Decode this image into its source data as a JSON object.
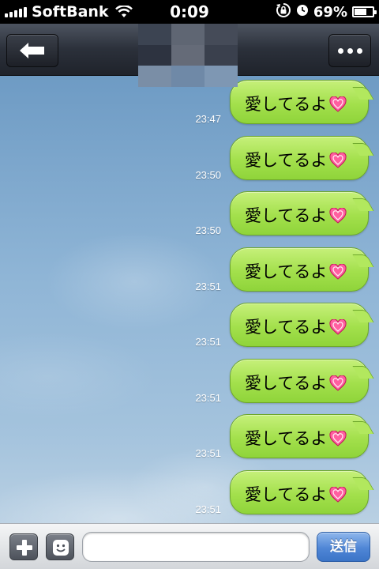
{
  "status_bar": {
    "carrier": "SoftBank",
    "time": "0:09",
    "battery_percent": "69%",
    "battery_level": 0.69,
    "icons": [
      "signal-icon",
      "wifi-icon",
      "rotation-lock-icon",
      "alarm-icon",
      "battery-icon"
    ]
  },
  "nav": {
    "back_icon": "back-arrow-icon",
    "more_icon": "more-dots-icon"
  },
  "messages": [
    {
      "text": "愛してるよ",
      "emoji": "heart-icon",
      "time": "23:47"
    },
    {
      "text": "愛してるよ",
      "emoji": "heart-icon",
      "time": "23:50"
    },
    {
      "text": "愛してるよ",
      "emoji": "heart-icon",
      "time": "23:50"
    },
    {
      "text": "愛してるよ",
      "emoji": "heart-icon",
      "time": "23:51"
    },
    {
      "text": "愛してるよ",
      "emoji": "heart-icon",
      "time": "23:51"
    },
    {
      "text": "愛してるよ",
      "emoji": "heart-icon",
      "time": "23:51"
    },
    {
      "text": "愛してるよ",
      "emoji": "heart-icon",
      "time": "23:51"
    },
    {
      "text": "愛してるよ",
      "emoji": "heart-icon",
      "time": "23:51"
    }
  ],
  "input_bar": {
    "plus_icon": "plus-icon",
    "sticker_icon": "smiley-icon",
    "input_value": "",
    "input_placeholder": "",
    "send_label": "送信"
  },
  "colors": {
    "bubble": "#a3e04c",
    "send_button": "#4f86d6",
    "heart": "#ff5fa0"
  }
}
